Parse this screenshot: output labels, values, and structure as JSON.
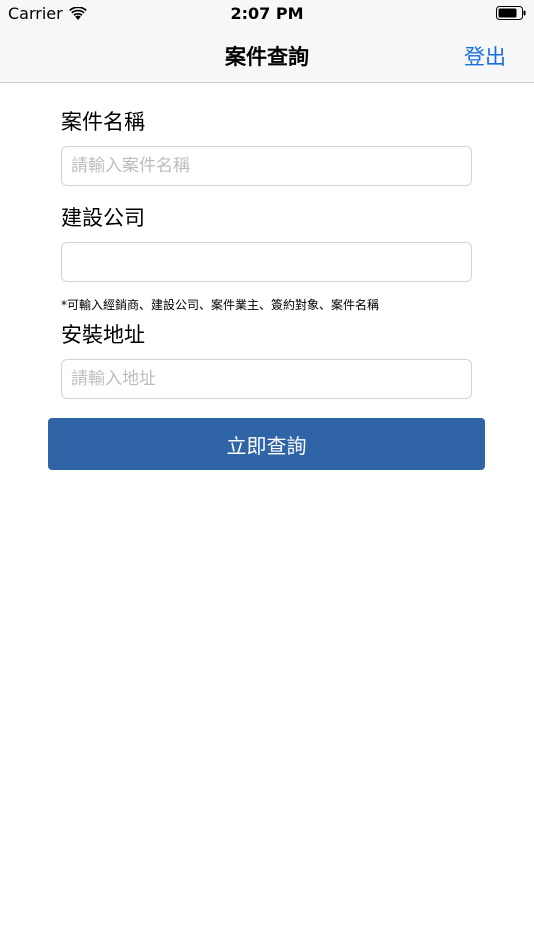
{
  "status_bar": {
    "carrier": "Carrier",
    "time": "2:07 PM"
  },
  "nav": {
    "title": "案件查詢",
    "logout_label": "登出"
  },
  "form": {
    "case_name": {
      "label": "案件名稱",
      "value": "",
      "placeholder": "請輸入案件名稱"
    },
    "company": {
      "label": "建設公司",
      "value": "",
      "placeholder": ""
    },
    "hint": "*可輸入經銷商、建設公司、案件業主、簽約對象、案件名稱",
    "address": {
      "label": "安裝地址",
      "value": "",
      "placeholder": "請輸入地址"
    },
    "submit_label": "立即查詢"
  },
  "colors": {
    "accent": "#1a6fe0",
    "button": "#2f64a7",
    "nav_background": "#f7f7f7"
  }
}
